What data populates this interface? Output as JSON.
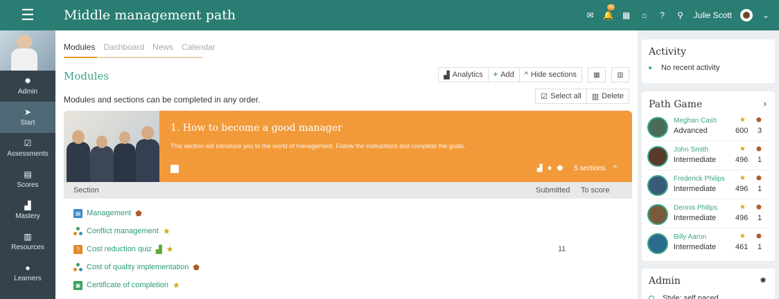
{
  "app": {
    "title": "Middle management path",
    "menu_icon": "menu-icon"
  },
  "header": {
    "notification_count": "30",
    "user_name": "Julie Scott"
  },
  "sidebar": {
    "items": [
      {
        "label": "Admin",
        "icon": "gear-icon"
      },
      {
        "label": "Start",
        "icon": "navigation-arrow-icon",
        "active": true
      },
      {
        "label": "Assessments",
        "icon": "check-square-icon"
      },
      {
        "label": "Scores",
        "icon": "scores-icon"
      },
      {
        "label": "Mastery",
        "icon": "bar-chart-icon"
      },
      {
        "label": "Resources",
        "icon": "books-icon"
      },
      {
        "label": "Learners",
        "icon": "person-icon"
      }
    ]
  },
  "tabs": [
    {
      "label": "Modules",
      "active": true
    },
    {
      "label": "Dashboard"
    },
    {
      "label": "News"
    },
    {
      "label": "Calendar"
    }
  ],
  "modules": {
    "title": "Modules",
    "description": "Modules and sections can be completed in any order.",
    "toolbar": {
      "analytics": "Analytics",
      "add": "Add",
      "hide_sections": "Hide sections"
    },
    "select_all": "Select all",
    "delete": "Delete"
  },
  "section": {
    "title": "1. How to become a good manager",
    "description": "This section will introduce you to the world of management. Follow the instructions and complete the goals.",
    "sections_count": "5 sections",
    "accent_color": "#f29a3a"
  },
  "table": {
    "headers": {
      "section": "Section",
      "submitted": "Submitted",
      "to_score": "To score"
    },
    "rows": [
      {
        "name": "Management",
        "type": "document",
        "submitted": ""
      },
      {
        "name": "Conflict management",
        "type": "path",
        "submitted": ""
      },
      {
        "name": "Cost reduction quiz",
        "type": "quiz",
        "submitted": "11"
      },
      {
        "name": "Cost of quality implementation",
        "type": "path",
        "submitted": ""
      },
      {
        "name": "Certificate of completion",
        "type": "certificate",
        "submitted": ""
      }
    ]
  },
  "activity": {
    "title": "Activity",
    "empty": "No recent activity"
  },
  "path_game": {
    "title": "Path Game",
    "players": [
      {
        "name": "Meghan Cash",
        "level": "Advanced",
        "points": "600",
        "badges": "3"
      },
      {
        "name": "John Smith",
        "level": "Intermediate",
        "points": "496",
        "badges": "1"
      },
      {
        "name": "Frederick Philips",
        "level": "Intermediate",
        "points": "496",
        "badges": "1"
      },
      {
        "name": "Dennis Philips",
        "level": "Intermediate",
        "points": "496",
        "badges": "1"
      },
      {
        "name": "Billy Aaron",
        "level": "Intermediate",
        "points": "461",
        "badges": "1"
      }
    ]
  },
  "admin_panel": {
    "title": "Admin",
    "style": "Style: self paced"
  },
  "colors": {
    "brand": "#2a7d73",
    "accent": "#3aa58a",
    "sidebar": "#34424c"
  }
}
